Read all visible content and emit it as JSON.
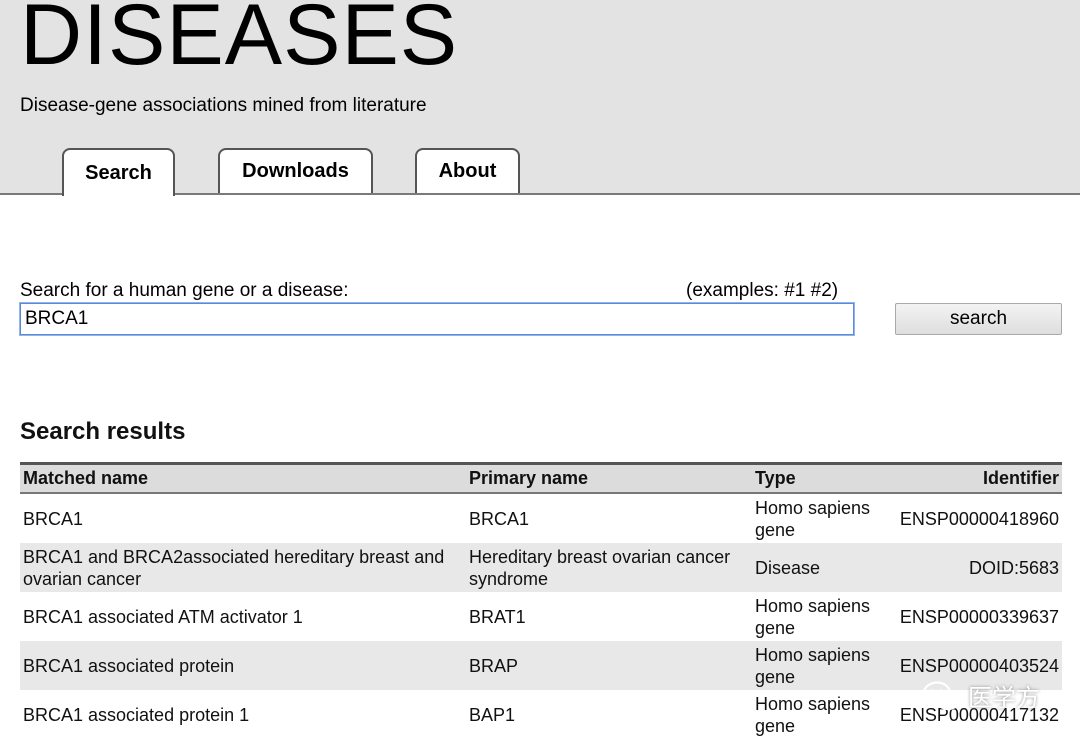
{
  "header": {
    "title": "DISEASES",
    "tagline": "Disease-gene associations mined from literature",
    "tabs": [
      {
        "label": "Search",
        "active": true
      },
      {
        "label": "Downloads",
        "active": false
      },
      {
        "label": "About",
        "active": false
      }
    ]
  },
  "search": {
    "label": "Search for a human gene or a disease:",
    "examples_prefix": "(examples:",
    "example_1": "#1",
    "example_2": "#2)",
    "value": "BRCA1",
    "button_label": "search"
  },
  "results": {
    "heading": "Search results",
    "columns": [
      "Matched name",
      "Primary name",
      "Type",
      "Identifier"
    ],
    "rows": [
      [
        "BRCA1",
        "BRCA1",
        "Homo sapiens gene",
        "ENSP00000418960"
      ],
      [
        "BRCA1 and BRCA2associated hereditary breast and ovarian cancer",
        "Hereditary breast ovarian cancer syndrome",
        "Disease",
        "DOID:5683"
      ],
      [
        "BRCA1 associated ATM activator 1",
        "BRAT1",
        "Homo sapiens gene",
        "ENSP00000339637"
      ],
      [
        "BRCA1 associated protein",
        "BRAP",
        "Homo sapiens gene",
        "ENSP00000403524"
      ],
      [
        "BRCA1 associated protein 1",
        "BAP1",
        "Homo sapiens gene",
        "ENSP00000417132"
      ]
    ]
  },
  "watermark": {
    "icon": "wechat-icon",
    "text": "医学方"
  },
  "colors": {
    "header_bg": "#e3e3e3",
    "row_alt": "#e8e8e8",
    "input_focus": "#5b8bd6"
  }
}
